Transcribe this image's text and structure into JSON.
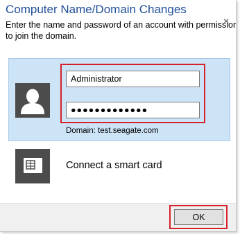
{
  "dialog": {
    "title": "Computer Name/Domain Changes",
    "description": "Enter the name and password of an account with permission to join the domain."
  },
  "credentials": {
    "username_value": "Administrator",
    "password_value": "●●●●●●●●●●●●●",
    "domain_text": "Domain: test.seagate.com",
    "avatar_icon": "user-icon"
  },
  "smart_card": {
    "label": "Connect a smart card",
    "icon": "smart-card-icon"
  },
  "footer": {
    "ok_label": "OK"
  },
  "colors": {
    "title": "#1f4e99",
    "selected_tile": "#cde4f7",
    "highlight_annotation": "#d62128",
    "icon_tile": "#4c4c4c"
  }
}
